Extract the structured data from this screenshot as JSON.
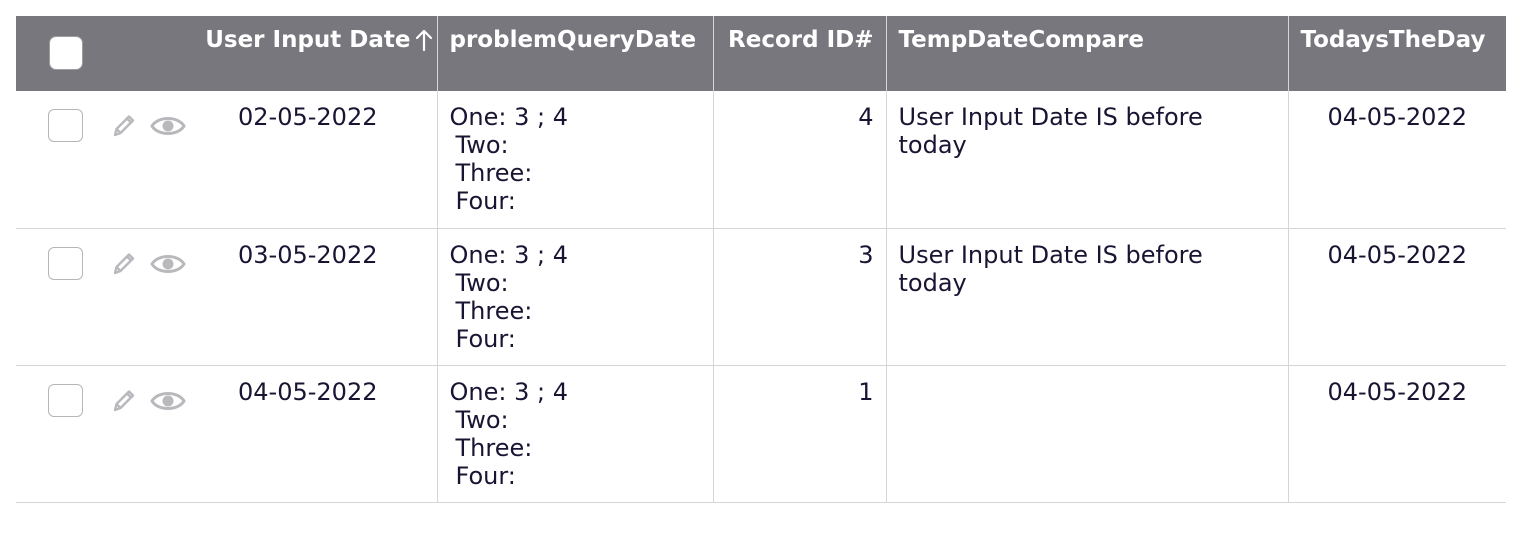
{
  "table": {
    "headers": {
      "user_input_date": "User Input Date",
      "problem_query_date": "problemQueryDate",
      "record_id": "Record ID#",
      "temp_date_compare": "TempDateCompare",
      "todays_the_day": "TodaysTheDay"
    },
    "sort": {
      "column": "user_input_date",
      "direction": "ascending",
      "icon": "arrow-up-icon"
    },
    "rows": [
      {
        "user_input_date": "02-05-2022",
        "problem_query": {
          "one": "One: 3 ; 4",
          "two": "Two:",
          "three": "Three:",
          "four": "Four:"
        },
        "record_id": "4",
        "temp_date_compare": "User Input Date IS before today",
        "todays_the_day": "04-05-2022"
      },
      {
        "user_input_date": "03-05-2022",
        "problem_query": {
          "one": "One: 3 ; 4",
          "two": "Two:",
          "three": "Three:",
          "four": "Four:"
        },
        "record_id": "3",
        "temp_date_compare": "User Input Date IS before today",
        "todays_the_day": "04-05-2022"
      },
      {
        "user_input_date": "04-05-2022",
        "problem_query": {
          "one": "One: 3 ; 4",
          "two": "Two:",
          "three": "Three:",
          "four": "Four:"
        },
        "record_id": "1",
        "temp_date_compare": "",
        "todays_the_day": "04-05-2022"
      }
    ],
    "icons": {
      "edit": "pencil-icon",
      "view": "eye-icon"
    },
    "colors": {
      "header_bg": "#78777e",
      "header_text": "#ffffff",
      "body_text": "#1a1433",
      "icon_gray": "#b9b9bd"
    }
  }
}
